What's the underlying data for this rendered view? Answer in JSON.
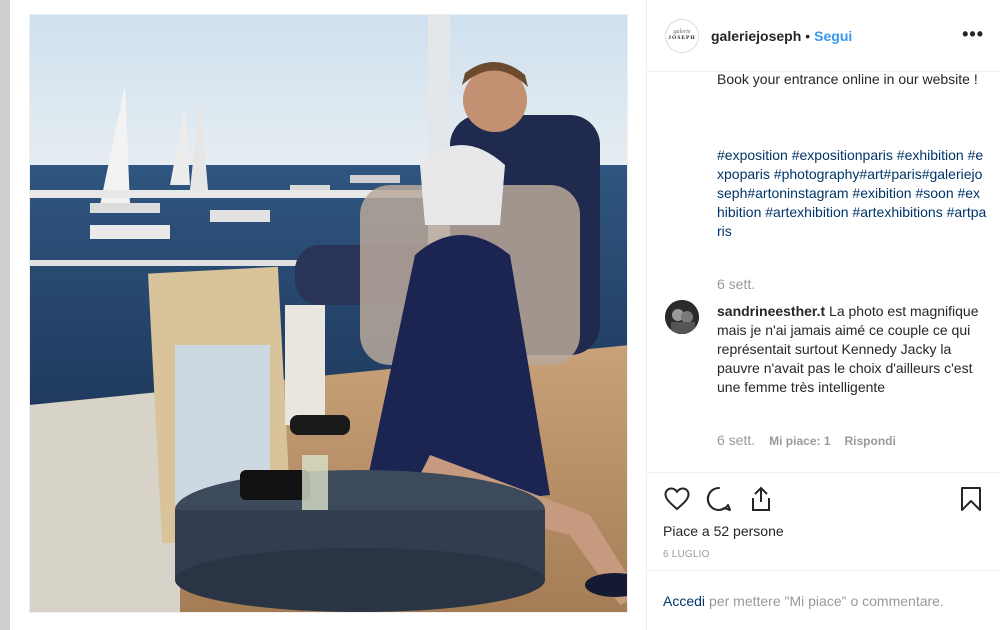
{
  "post": {
    "username": "galeriejoseph",
    "separator": "•",
    "follow_label": "Segui",
    "more_label": "•••",
    "logo_top": "galerie",
    "logo_bottom": "JOSEPH"
  },
  "caption": {
    "text": "Book your entrance online in our website !",
    "hashtags": "#exposition #expositionparis #exhibition #expoparis #photography#art#paris#galeriejoseph#artoninstagram #exibition #soon #exhibition #artexhibition #artexhibitions #artparis",
    "time": "6 sett."
  },
  "comment": {
    "username": "sandrineesther.t",
    "text": "La photo est magnifique mais je n'ai jamais aimé ce couple ce qui représentait surtout Kennedy Jacky la pauvre n'avait pas le choix d'ailleurs c'est une femme très intelligente",
    "time": "6 sett.",
    "likes": "Mi piace: 1",
    "reply_label": "Rispondi"
  },
  "engagement": {
    "likes_text": "Piace a 52 persone",
    "date": "6 LUGLIO"
  },
  "login": {
    "link_label": "Accedi",
    "suffix": "per mettere \"Mi piace\" o commentare."
  },
  "icons": {
    "like": "heart-icon",
    "comment": "comment-icon",
    "share": "share-icon",
    "save": "bookmark-icon"
  },
  "colors": {
    "follow": "#3897f0",
    "link": "#003569",
    "muted": "#999999"
  }
}
